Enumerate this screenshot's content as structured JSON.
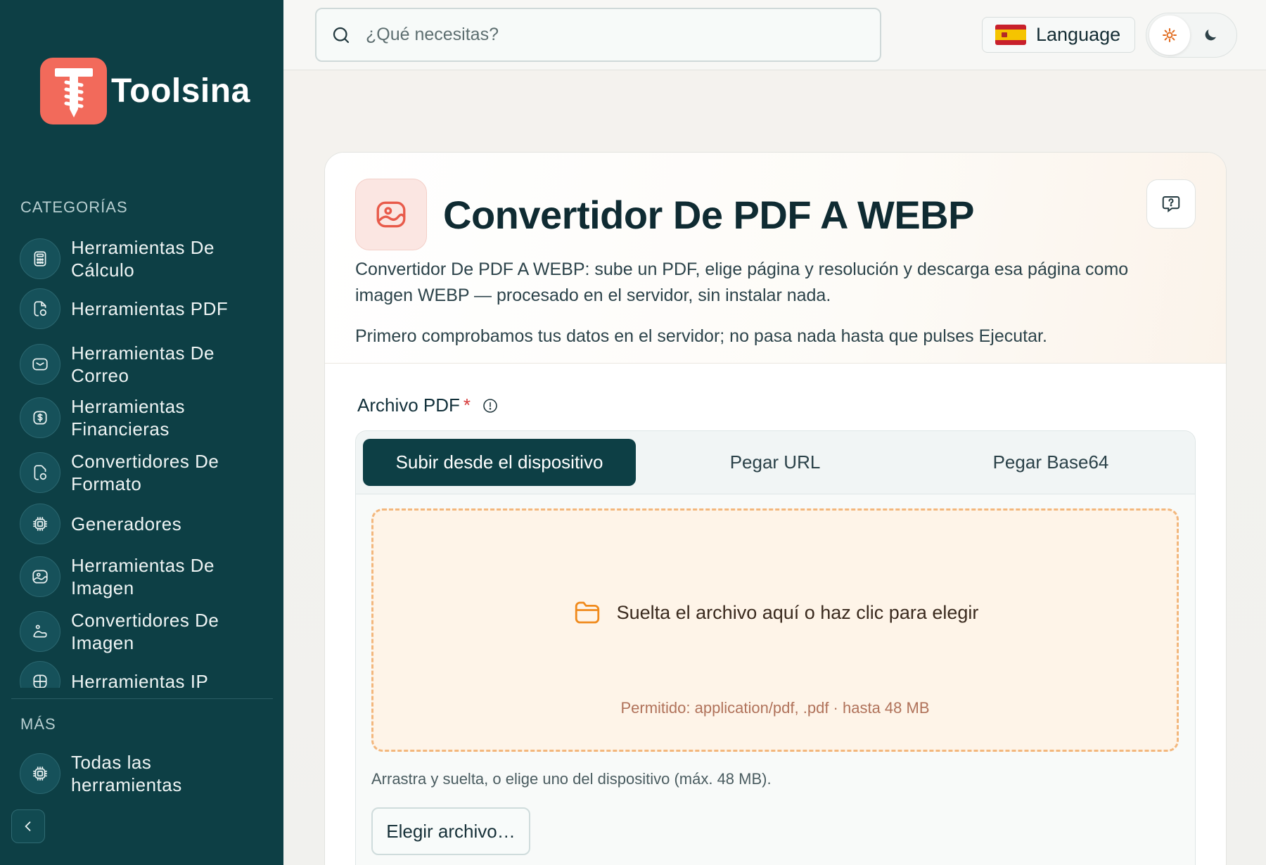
{
  "brand": {
    "name": "Toolsina",
    "accent": "#f26a5b",
    "sidebar_bg": "#0d3f45"
  },
  "search": {
    "placeholder": "¿Qué necesitas?"
  },
  "header": {
    "language_label": "Language"
  },
  "sidebar": {
    "categories_label": "CATEGORÍAS",
    "items": [
      {
        "label": "Herramientas De Cálculo",
        "icon": "calculator-icon"
      },
      {
        "label": "Herramientas PDF",
        "icon": "pdf-icon"
      },
      {
        "label": "Herramientas De Correo",
        "icon": "mail-icon"
      },
      {
        "label": "Herramientas Financieras",
        "icon": "dollar-icon"
      },
      {
        "label": "Convertidores De Formato",
        "icon": "convert-icon"
      },
      {
        "label": "Generadores",
        "icon": "chip-icon"
      },
      {
        "label": "Herramientas De Imagen",
        "icon": "image-icon"
      },
      {
        "label": "Convertidores De Imagen",
        "icon": "image-convert-icon"
      },
      {
        "label": "Herramientas IP",
        "icon": "network-icon"
      }
    ],
    "more_label": "MÁS",
    "more_items": [
      {
        "label": "Todas las herramientas",
        "icon": "chip-icon"
      }
    ]
  },
  "tool": {
    "title": "Convertidor De PDF A WEBP",
    "description": "Convertidor De PDF A WEBP: sube un PDF, elige página y resolución y descarga esa página como imagen WEBP — procesado en el servidor, sin instalar nada.",
    "note": "Primero comprobamos tus datos en el servidor; no pasa nada hasta que pulses Ejecutar.",
    "field_label": "Archivo PDF",
    "required_mark": "*",
    "tabs": [
      "Subir desde el dispositivo",
      "Pegar URL",
      "Pegar Base64"
    ],
    "active_tab": 0,
    "dropzone_text": "Suelta el archivo aquí o haz clic para elegir",
    "allowed_text": "Permitido: application/pdf, .pdf · hasta 48 MB",
    "hint": "Arrastra y suelta, o elige uno del dispositivo (máx. 48 MB).",
    "choose_button": "Elegir archivo…"
  }
}
